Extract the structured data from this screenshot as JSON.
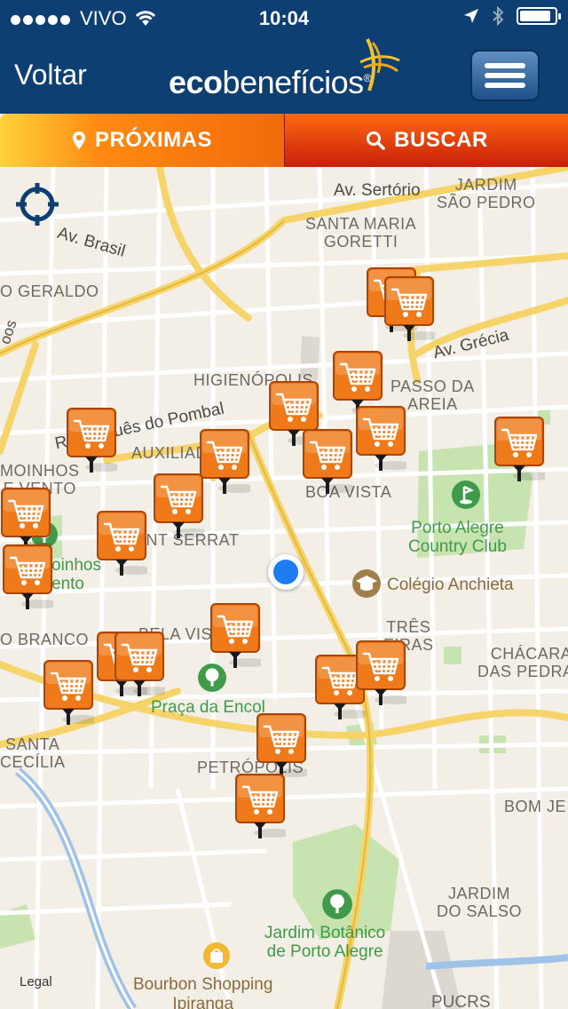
{
  "status": {
    "carrier": "VIVO",
    "time": "10:04"
  },
  "nav": {
    "back_label": "Voltar",
    "logo_bold": "eco",
    "logo_rest": "benefícios",
    "logo_mark": "®"
  },
  "tabs": [
    {
      "label": "PRÓXIMAS"
    },
    {
      "label": "BUSCAR"
    }
  ],
  "map": {
    "neighborhoods": {
      "jardim_sao_pedro": "JARDIM\nSÃO PEDRO",
      "santa_maria_goretti": "SANTA MARIA\nGORETTI",
      "sao_geraldo": "O GERALDO",
      "higienopolis": "HIGIENÓPOLIS",
      "passo_da_areia": "PASSO DA\nAREIA",
      "auxiliadora": "AUXILIADO",
      "moinhos_de_vento": "MOINHOS\nE VENTO",
      "boa_vista": "BOA VISTA",
      "mont_serrat": "ONT SERRAT",
      "rio_branco": "O BRANCO",
      "bela_vista": "BELA VIS",
      "tres_figueiras": "TRÊS\nEIRAS",
      "chacara_das_pedras": "CHÁCARA\nDAS PEDRAS",
      "santa_cecilia": "SANTA\nCECÍLIA",
      "petropolis": "PETRÓPOLIS",
      "bom_jesus": "BOM JE",
      "jardim_do_salso": "JARDIM\nDO SALSO"
    },
    "roads": {
      "av_sertorio": "Av. Sertório",
      "av_brasil": "Av. Brasil",
      "av_grecia": "Av. Grécia",
      "marques_pombal": "R. Marquês do Pombal",
      "oos": "oos"
    },
    "parks": {
      "country_club": "Porto Alegre\nCountry Club",
      "moinhos_vento": "oinhos\nento",
      "praca_encol": "Praça da Encol",
      "jardim_botanico": "Jardim Botânico\nde Porto Alegre"
    },
    "pois": {
      "colegio_anchieta": "Colégio Anchieta",
      "bourbon": "Bourbon Shopping\nIpiranga",
      "pucrs": "PUCRS"
    },
    "legal": "Legal"
  },
  "colors": {
    "nav": "#0d3f73",
    "accent": "#f26a0a",
    "pin": "#f07a1a",
    "user_dot": "#1e7cf2"
  }
}
